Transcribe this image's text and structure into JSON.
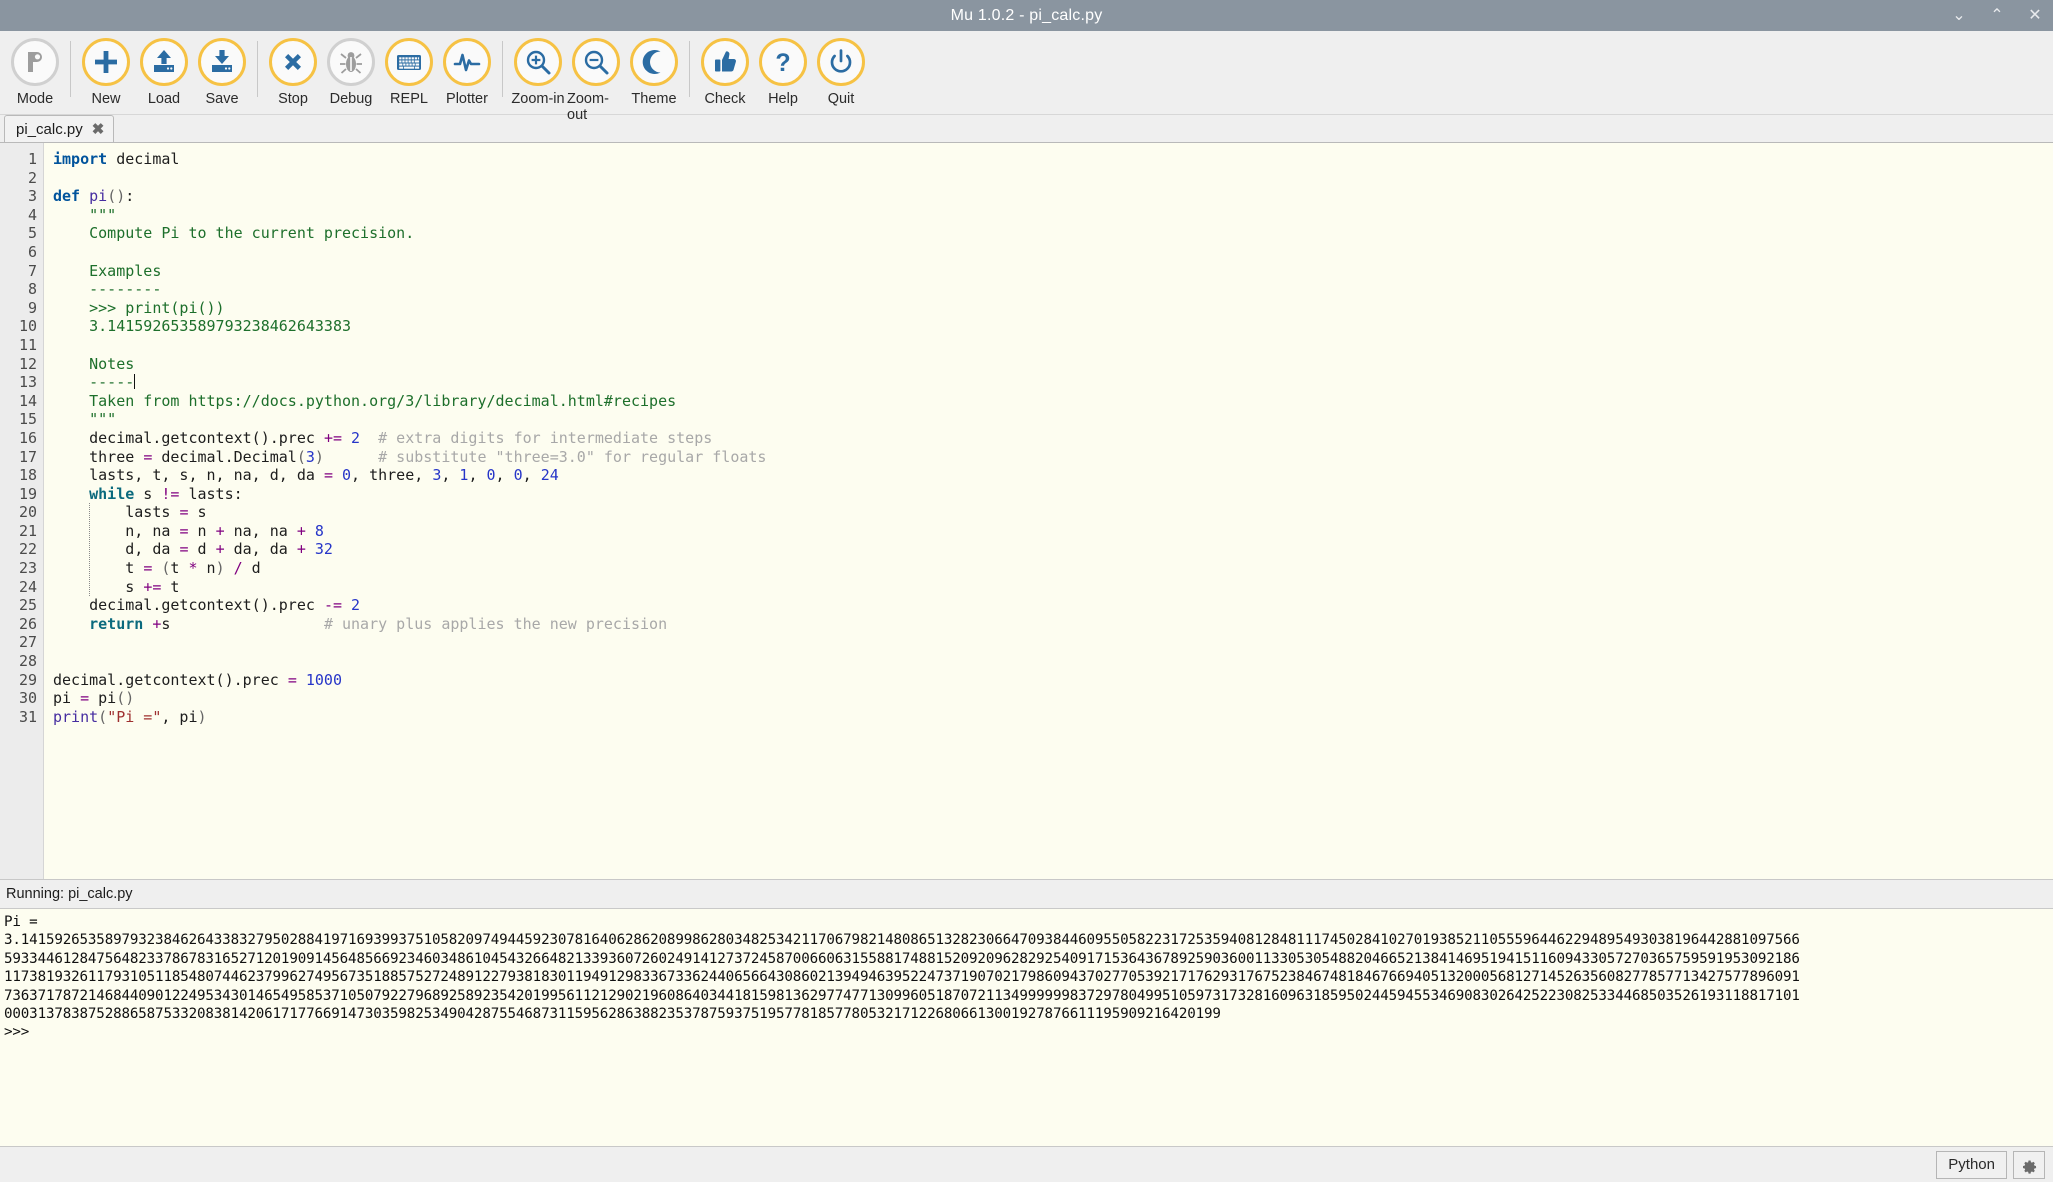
{
  "window": {
    "title": "Mu 1.0.2 - pi_calc.py",
    "controls": [
      {
        "name": "minimize-button",
        "glyph": "⌄"
      },
      {
        "name": "maximize-button",
        "glyph": "⌃"
      },
      {
        "name": "close-button",
        "glyph": "✕"
      }
    ]
  },
  "toolbar": {
    "items": [
      {
        "label": "Mode",
        "icon": "mode-icon",
        "enabled": false
      },
      {
        "label": "New",
        "icon": "plus-icon",
        "enabled": true
      },
      {
        "label": "Load",
        "icon": "upload-icon",
        "enabled": true
      },
      {
        "label": "Save",
        "icon": "download-icon",
        "enabled": true
      },
      {
        "label": "Stop",
        "icon": "cross-icon",
        "enabled": true
      },
      {
        "label": "Debug",
        "icon": "bug-icon",
        "enabled": false
      },
      {
        "label": "REPL",
        "icon": "keyboard-icon",
        "enabled": true
      },
      {
        "label": "Plotter",
        "icon": "waveform-icon",
        "enabled": true
      },
      {
        "label": "Zoom-in",
        "icon": "zoom-in-icon",
        "enabled": true
      },
      {
        "label": "Zoom-out",
        "icon": "zoom-out-icon",
        "enabled": true
      },
      {
        "label": "Theme",
        "icon": "moon-icon",
        "enabled": true
      },
      {
        "label": "Check",
        "icon": "thumbs-up-icon",
        "enabled": true
      },
      {
        "label": "Help",
        "icon": "question-icon",
        "enabled": true
      },
      {
        "label": "Quit",
        "icon": "power-icon",
        "enabled": true
      }
    ]
  },
  "tabs": [
    {
      "label": "pi_calc.py",
      "close_glyph": "✖",
      "active": true
    }
  ],
  "editor": {
    "line_count": 31,
    "lines": [
      [
        [
          "k",
          "import"
        ],
        [
          "t",
          " decimal"
        ]
      ],
      [],
      [
        [
          "k",
          "def"
        ],
        [
          "t",
          " "
        ],
        [
          "fn",
          "pi"
        ],
        [
          "pn",
          "()"
        ],
        [
          "t",
          ":"
        ]
      ],
      [
        [
          "t",
          "    "
        ],
        [
          "doc",
          "\"\"\""
        ]
      ],
      [
        [
          "t",
          "    "
        ],
        [
          "doc",
          "Compute Pi to the current precision."
        ]
      ],
      [],
      [
        [
          "t",
          "    "
        ],
        [
          "doc",
          "Examples"
        ]
      ],
      [
        [
          "t",
          "    "
        ],
        [
          "doc",
          "--------"
        ]
      ],
      [
        [
          "t",
          "    "
        ],
        [
          "doc",
          ">>> print(pi())"
        ]
      ],
      [
        [
          "t",
          "    "
        ],
        [
          "doc",
          "3.141592653589793238462643383"
        ]
      ],
      [],
      [
        [
          "t",
          "    "
        ],
        [
          "doc",
          "Notes"
        ]
      ],
      [
        [
          "t",
          "    "
        ],
        [
          "doc",
          "-----"
        ],
        [
          "caret",
          ""
        ]
      ],
      [
        [
          "t",
          "    "
        ],
        [
          "doc",
          "Taken from https://docs.python.org/3/library/decimal.html#recipes"
        ]
      ],
      [
        [
          "t",
          "    "
        ],
        [
          "doc",
          "\"\"\""
        ]
      ],
      [
        [
          "t",
          "    decimal.getcontext().prec "
        ],
        [
          "op",
          "+="
        ],
        [
          "t",
          " "
        ],
        [
          "nm",
          "2"
        ],
        [
          "t",
          "  "
        ],
        [
          "cm",
          "# extra digits for intermediate steps"
        ]
      ],
      [
        [
          "t",
          "    three "
        ],
        [
          "op",
          "="
        ],
        [
          "t",
          " decimal.Decimal"
        ],
        [
          "pn",
          "("
        ],
        [
          "nm",
          "3"
        ],
        [
          "pn",
          ")"
        ],
        [
          "t",
          "      "
        ],
        [
          "cm",
          "# substitute \"three=3.0\" for regular floats"
        ]
      ],
      [
        [
          "t",
          "    lasts, t, s, n, na, d, da "
        ],
        [
          "op",
          "="
        ],
        [
          "t",
          " "
        ],
        [
          "nm",
          "0"
        ],
        [
          "t",
          ", three, "
        ],
        [
          "nm",
          "3"
        ],
        [
          "t",
          ", "
        ],
        [
          "nm",
          "1"
        ],
        [
          "t",
          ", "
        ],
        [
          "nm",
          "0"
        ],
        [
          "t",
          ", "
        ],
        [
          "nm",
          "0"
        ],
        [
          "t",
          ", "
        ],
        [
          "nm",
          "24"
        ]
      ],
      [
        [
          "t",
          "    "
        ],
        [
          "kw",
          "while"
        ],
        [
          "t",
          " s "
        ],
        [
          "op",
          "!="
        ],
        [
          "t",
          " lasts:"
        ]
      ],
      [
        [
          "t",
          "        lasts "
        ],
        [
          "op",
          "="
        ],
        [
          "t",
          " s"
        ]
      ],
      [
        [
          "t",
          "        n, na "
        ],
        [
          "op",
          "="
        ],
        [
          "t",
          " n "
        ],
        [
          "op",
          "+"
        ],
        [
          "t",
          " na, na "
        ],
        [
          "op",
          "+"
        ],
        [
          "t",
          " "
        ],
        [
          "nm",
          "8"
        ]
      ],
      [
        [
          "t",
          "        d, da "
        ],
        [
          "op",
          "="
        ],
        [
          "t",
          " d "
        ],
        [
          "op",
          "+"
        ],
        [
          "t",
          " da, da "
        ],
        [
          "op",
          "+"
        ],
        [
          "t",
          " "
        ],
        [
          "nm",
          "32"
        ]
      ],
      [
        [
          "t",
          "        t "
        ],
        [
          "op",
          "="
        ],
        [
          "t",
          " "
        ],
        [
          "pn",
          "("
        ],
        [
          "t",
          "t "
        ],
        [
          "op",
          "*"
        ],
        [
          "t",
          " n"
        ],
        [
          "pn",
          ")"
        ],
        [
          "t",
          " "
        ],
        [
          "op",
          "/"
        ],
        [
          "t",
          " d"
        ]
      ],
      [
        [
          "t",
          "        s "
        ],
        [
          "op",
          "+="
        ],
        [
          "t",
          " t"
        ]
      ],
      [
        [
          "t",
          "    decimal.getcontext().prec "
        ],
        [
          "op",
          "-="
        ],
        [
          "t",
          " "
        ],
        [
          "nm",
          "2"
        ]
      ],
      [
        [
          "t",
          "    "
        ],
        [
          "kw",
          "return"
        ],
        [
          "t",
          " "
        ],
        [
          "op",
          "+"
        ],
        [
          "t",
          "s                 "
        ],
        [
          "cm",
          "# unary plus applies the new precision"
        ]
      ],
      [],
      [],
      [
        [
          "t",
          "decimal.getcontext().prec "
        ],
        [
          "op",
          "="
        ],
        [
          "t",
          " "
        ],
        [
          "nm",
          "1000"
        ]
      ],
      [
        [
          "t",
          "pi "
        ],
        [
          "op",
          "="
        ],
        [
          "t",
          " pi"
        ],
        [
          "pn",
          "()"
        ]
      ],
      [
        [
          "fn",
          "print"
        ],
        [
          "pn",
          "("
        ],
        [
          "st",
          "\"Pi =\""
        ],
        [
          "t",
          ", pi"
        ],
        [
          "pn",
          ")"
        ]
      ]
    ]
  },
  "runner": {
    "header": "Running: pi_calc.py",
    "output_lines": [
      "Pi =",
      "3.14159265358979323846264338327950288419716939937510582097494459230781640628620899862803482534211706798214808651328230664709384460955058223172535940812848111745028410270193852110555964462294895493038196442881097566",
      "5933446128475648233786783165271201909145648566923460348610454326648213393607260249141273724587006606315588174881520920962829254091715364367892590360011330530548820466521384146951941511609433057270365759591953092186",
      "1173819326117931051185480744623799627495673518857527248912279381830119491298336733624406566430860213949463952247371907021798609437027705392171762931767523846748184676694051320005681271452635608277857713427577896091",
      "7363717872146844090122495343014654958537105079227968925892354201995611212902196086403441815981362977477130996051870721134999999837297804995105973173281609631859502445945534690830264252230825334468503526193118817101",
      "0003137838752886587533208381420617177669147303598253490428755468731159562863882353787593751957781857780532171226806613001927876611195909216420199",
      ">>>"
    ]
  },
  "statusbar": {
    "mode_label": "Python",
    "gear_glyph": "⚙"
  },
  "colors": {
    "titlebar": "#8a95a0",
    "accent_ring": "#f6c244",
    "icon_blue": "#2b6ca3",
    "editor_bg": "#fdfdf0",
    "chrome": "#efefef"
  }
}
